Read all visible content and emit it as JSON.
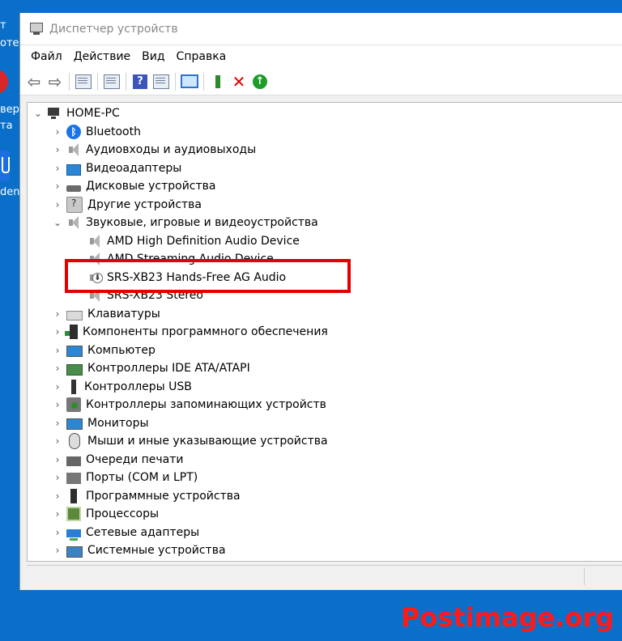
{
  "desktop": {
    "fragments": [
      "т",
      "отер",
      "вер",
      "та",
      "den"
    ]
  },
  "window": {
    "title": "Диспетчер устройств"
  },
  "menu": [
    "Файл",
    "Действие",
    "Вид",
    "Справка"
  ],
  "tree": {
    "root": "HOME-PC",
    "nodes": [
      {
        "label": "Bluetooth",
        "icon": "bluetooth-icon"
      },
      {
        "label": "Аудиовходы и аудиовыходы",
        "icon": "speaker-icon"
      },
      {
        "label": "Видеоадаптеры",
        "icon": "display-adapter-icon"
      },
      {
        "label": "Дисковые устройства",
        "icon": "disk-drive-icon"
      },
      {
        "label": "Другие устройства",
        "icon": "unknown-device-icon"
      },
      {
        "label": "Звуковые, игровые и видеоустройства",
        "icon": "speaker-icon",
        "expanded": true,
        "children": [
          {
            "label": "AMD High Definition Audio Device",
            "icon": "speaker-icon"
          },
          {
            "label": "AMD Streaming Audio Device",
            "icon": "speaker-icon"
          },
          {
            "label": "SRS-XB23 Hands-Free AG Audio",
            "icon": "speaker-bluetooth-icon"
          },
          {
            "label": "SRS-XB23 Stereo",
            "icon": "speaker-icon"
          }
        ]
      },
      {
        "label": "Клавиатуры",
        "icon": "keyboard-icon"
      },
      {
        "label": "Компоненты программного обеспечения",
        "icon": "software-component-icon"
      },
      {
        "label": "Компьютер",
        "icon": "computer-icon"
      },
      {
        "label": "Контроллеры IDE ATA/ATAPI",
        "icon": "ide-controller-icon"
      },
      {
        "label": "Контроллеры USB",
        "icon": "usb-icon"
      },
      {
        "label": "Контроллеры запоминающих устройств",
        "icon": "storage-controller-icon"
      },
      {
        "label": "Мониторы",
        "icon": "monitor-icon"
      },
      {
        "label": "Мыши и иные указывающие устройства",
        "icon": "mouse-icon"
      },
      {
        "label": "Очереди печати",
        "icon": "printer-icon"
      },
      {
        "label": "Порты (COM и LPT)",
        "icon": "port-icon"
      },
      {
        "label": "Программные устройства",
        "icon": "software-device-icon"
      },
      {
        "label": "Процессоры",
        "icon": "processor-icon"
      },
      {
        "label": "Сетевые адаптеры",
        "icon": "network-adapter-icon"
      },
      {
        "label": "Системные устройства",
        "icon": "system-device-icon"
      }
    ]
  },
  "watermark": "Postimage.org",
  "colors": {
    "highlight": "#e10000",
    "watermark": "#ff1a1a",
    "desktop": "#0a6fc9"
  }
}
